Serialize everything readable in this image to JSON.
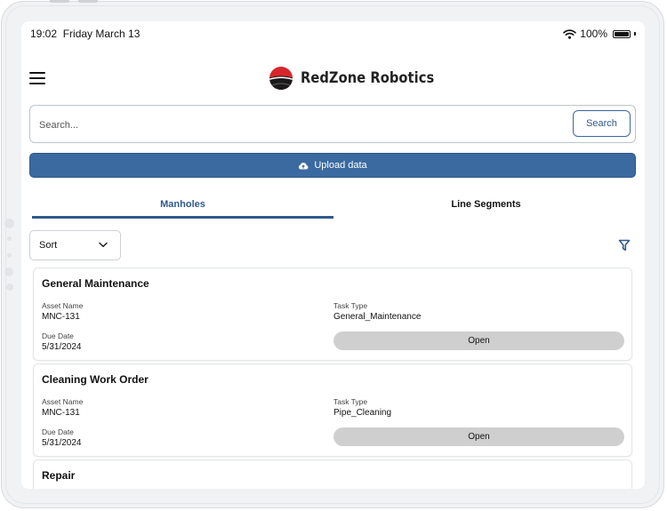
{
  "status_bar": {
    "time": "19:02",
    "date": "Friday March 13",
    "battery": "100%",
    "battery_level": 1.0
  },
  "header": {
    "app_name": "RedZone Robotics"
  },
  "search": {
    "placeholder": "Search...",
    "value": "",
    "button_label": "Search"
  },
  "upload": {
    "label": "Upload data"
  },
  "tabs": [
    {
      "label": "Manholes",
      "active": true
    },
    {
      "label": "Line Segments",
      "active": false
    }
  ],
  "sort": {
    "label": "Sort"
  },
  "work_orders": [
    {
      "title": "General Maintenance",
      "asset_label": "Asset Name",
      "asset": "MNC-131",
      "task_label": "Task Type",
      "task": "General_Maintenance",
      "due_label": "Due Date",
      "due": "5/31/2024",
      "action": "Open"
    },
    {
      "title": "Cleaning Work Order",
      "asset_label": "Asset Name",
      "asset": "MNC-131",
      "task_label": "Task Type",
      "task": "Pipe_Cleaning",
      "due_label": "Due Date",
      "due": "5/31/2024",
      "action": "Open"
    },
    {
      "title": "Repair"
    }
  ],
  "colors": {
    "accent": "#2f5a8c",
    "upload_bg": "#3b6aa0",
    "open_button_bg": "#cfcfcf",
    "logo_red": "#d7262b"
  },
  "icons": [
    "menu-icon",
    "redzone-logo-icon",
    "wifi-icon",
    "battery-icon",
    "cloud-upload-icon",
    "chevron-down-icon",
    "filter-icon"
  ]
}
